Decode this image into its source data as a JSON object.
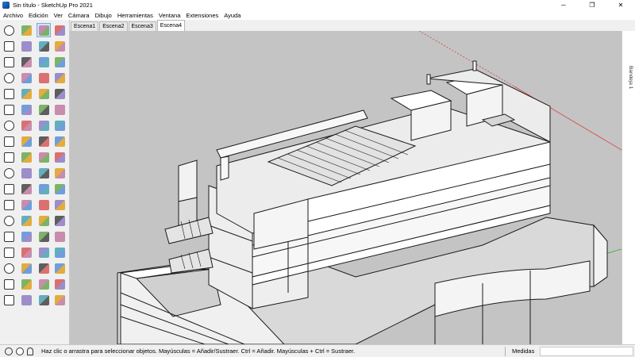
{
  "window": {
    "title": "Sin título - SketchUp Pro 2021",
    "minimize": "─",
    "restore": "❐",
    "close": "✕"
  },
  "menu": [
    "Archivo",
    "Edición",
    "Ver",
    "Cámara",
    "Dibujo",
    "Herramientas",
    "Ventana",
    "Extensiones",
    "Ayuda"
  ],
  "scene_tabs": [
    {
      "label": "Escena1",
      "active": false
    },
    {
      "label": "Escena2",
      "active": false
    },
    {
      "label": "Escena3",
      "active": false
    },
    {
      "label": "Escena4",
      "active": true
    }
  ],
  "tray": {
    "label": "Bandeja 1"
  },
  "status": {
    "hint": "Haz clic o arrastra para seleccionar objetos. Mayúsculas = Añadir/Sustraer. Ctrl = Añadir. Mayúsculas + Ctrl = Sustraer.",
    "measurements_label": "Medidas",
    "measurements_value": ""
  },
  "toolbar": {
    "col1": [
      "instructor-icon",
      "teapot-icon",
      "house-icon",
      "cloud-icon",
      "rotate-icon",
      "separator-icon",
      "section-icon",
      "warehouse-icon",
      "camera-icon",
      "model-icon",
      "component-icon",
      "layers-icon",
      "style-icon",
      "scene-icon",
      "outliner-icon",
      "help-icon",
      "search-icon",
      "info-icon"
    ],
    "col2": [
      "orbit-icon",
      "cube-icon",
      "house-line-icon",
      "house-small-icon",
      "house-solid-icon",
      "cube-yellow-icon",
      "cube-gray-icon",
      "cube-green-icon",
      "paint-cube-icon",
      "arrow-blue-icon",
      "follow-icon",
      "arrows-icon",
      "stairs-icon",
      "arrows-split-icon",
      "line-icon",
      "zoom-icon",
      "pan-icon",
      "walk-icon"
    ],
    "col3": [
      "select-icon",
      "paint-icon",
      "line-draw-icon",
      "rect-icon",
      "circle-icon",
      "polygon-icon",
      "arc-icon",
      "push-pull-icon",
      "move-icon",
      "rotate-tool-icon",
      "scale-icon",
      "offset-icon",
      "tape-icon",
      "text-icon",
      "dimension-icon",
      "axes-icon",
      "look-icon",
      "position-icon"
    ],
    "col4": [
      "component-select-icon",
      "eraser-icon",
      "freehand-icon",
      "rotated-rect-icon",
      "pie-icon",
      "ellipse-icon",
      "arc3-icon",
      "follow-me-icon",
      "move-copy-icon",
      "rotate-copy-icon",
      "flip-icon",
      "intersect-icon",
      "protractor-icon",
      "text3d-icon",
      "zoom-window-icon",
      "zoom-extents-icon",
      "eye-icon",
      "footprint-icon"
    ],
    "selected": "select-icon"
  },
  "colors": {
    "viewport_bg": "#c4c4c4",
    "model_face": "#ececec",
    "model_edge": "#1a1a1a",
    "axis_red": "#d44",
    "axis_green": "#3a3"
  }
}
